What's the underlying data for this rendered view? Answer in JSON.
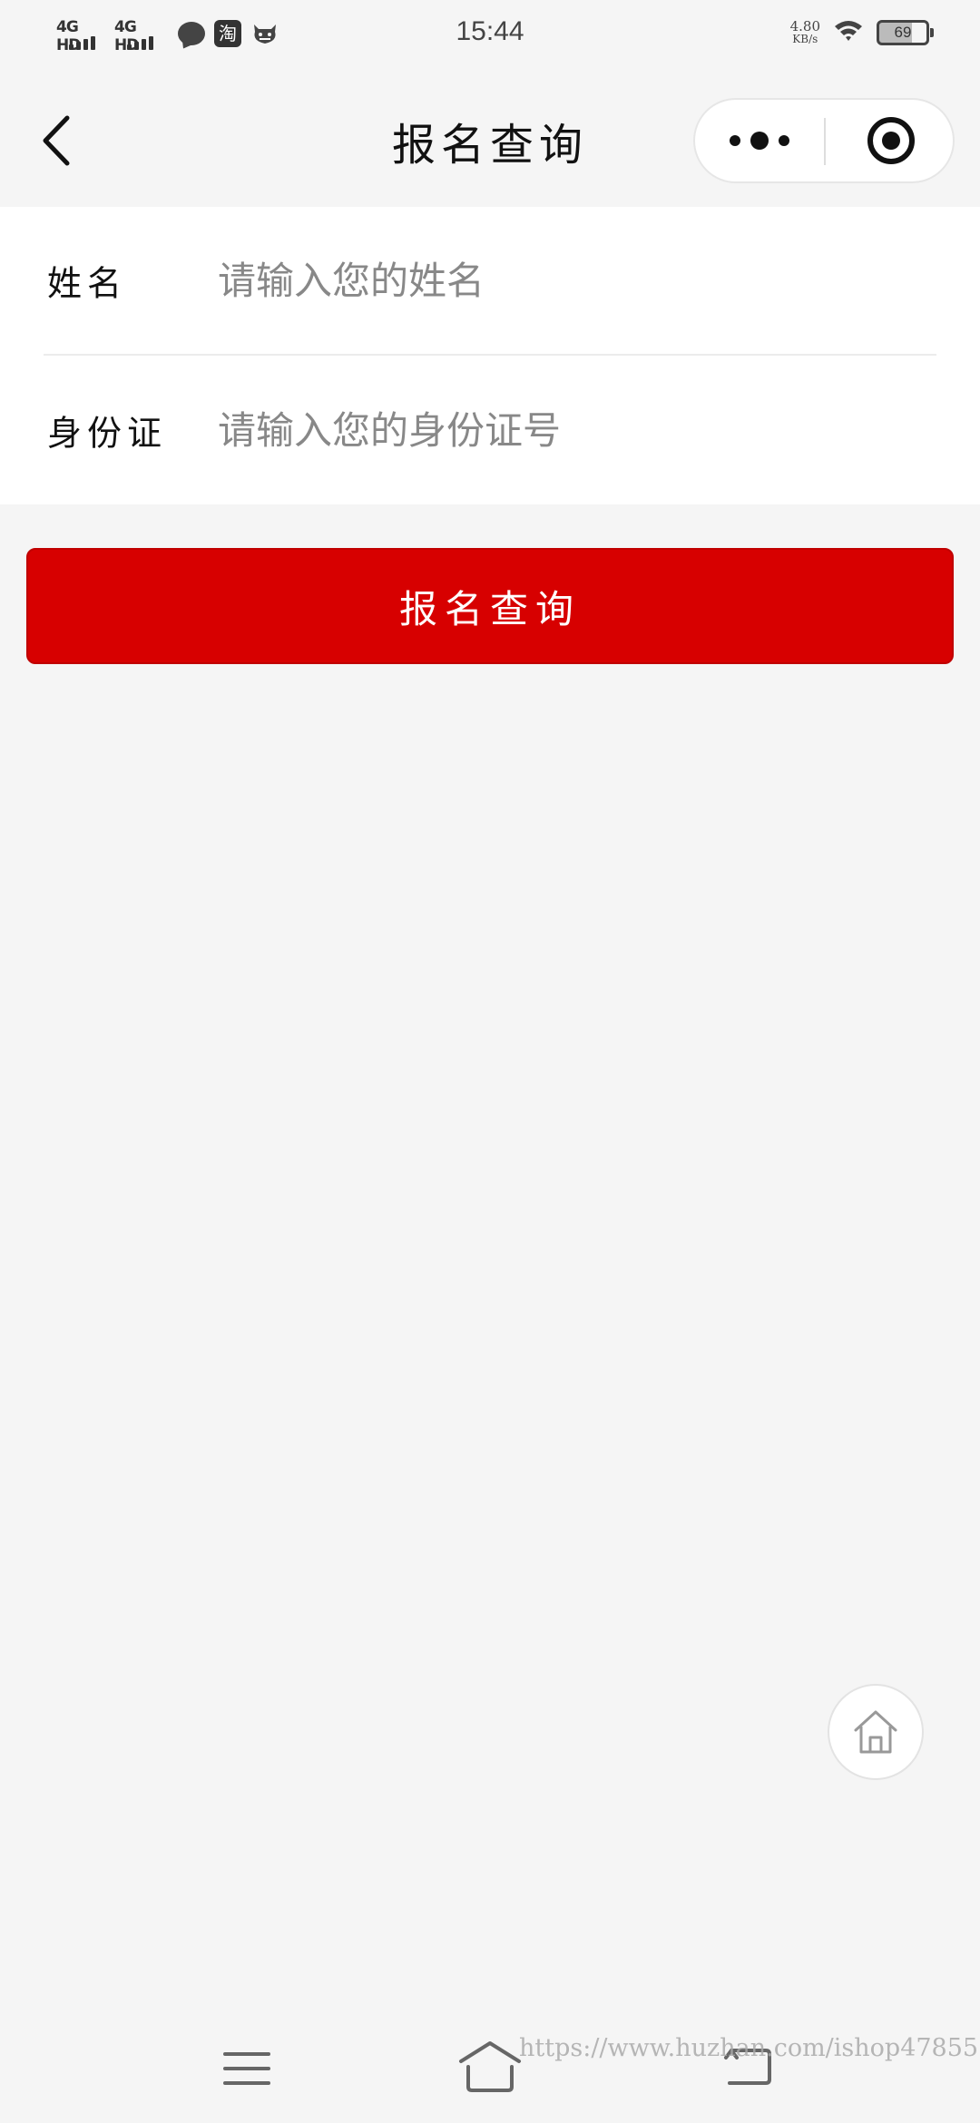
{
  "status_bar": {
    "network_1": "4G HD",
    "network_2": "4G HD",
    "time": "15:44",
    "speed_value": "4.80",
    "speed_unit": "KB/s",
    "battery_level": "69",
    "app_icons": [
      "message-icon",
      "taobao-icon",
      "bull-icon"
    ],
    "taobao_glyph": "淘"
  },
  "nav": {
    "title": "报名查询",
    "back_icon": "chevron-left-icon",
    "more_icon": "more-dots-icon",
    "close_icon": "target-close-icon"
  },
  "form": {
    "name_label": "姓名",
    "name_placeholder": "请输入您的姓名",
    "name_value": "",
    "id_label": "身份证",
    "id_placeholder": "请输入您的身份证号",
    "id_value": ""
  },
  "submit_label": "报名查询",
  "fab_icon": "home-icon",
  "system_nav": {
    "menu_icon": "menu-icon",
    "home_icon": "home-outline-icon",
    "back_icon": "back-icon"
  },
  "watermark": "https://www.huzhan.com/ishop47855",
  "colors": {
    "primary_button": "#d70000",
    "background": "#f5f5f5",
    "card": "#ffffff",
    "placeholder": "#888888"
  }
}
